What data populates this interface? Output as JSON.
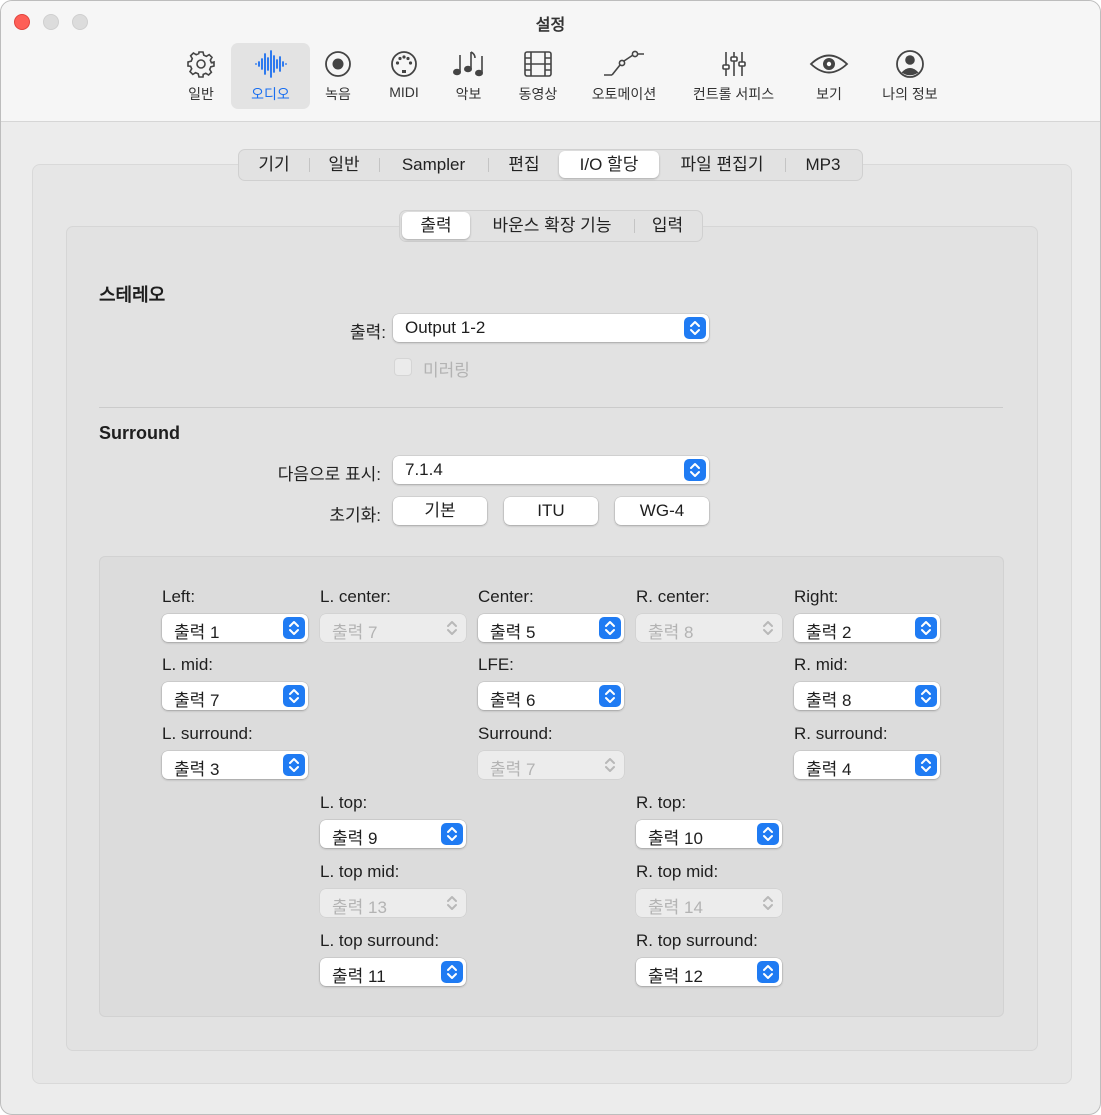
{
  "window": {
    "title": "설정"
  },
  "toolbar": {
    "items": [
      {
        "label": "일반",
        "icon": "gear-icon"
      },
      {
        "label": "오디오",
        "icon": "waveform-icon"
      },
      {
        "label": "녹음",
        "icon": "record-icon"
      },
      {
        "label": "MIDI",
        "icon": "midi-port-icon"
      },
      {
        "label": "악보",
        "icon": "music-notes-icon"
      },
      {
        "label": "동영상",
        "icon": "film-icon"
      },
      {
        "label": "오토메이션",
        "icon": "automation-curve-icon"
      },
      {
        "label": "컨트롤 서피스",
        "icon": "sliders-icon"
      },
      {
        "label": "보기",
        "icon": "eye-icon"
      },
      {
        "label": "나의 정보",
        "icon": "person-circle-icon"
      }
    ],
    "selected": "오디오"
  },
  "tabs": [
    "기기",
    "일반",
    "Sampler",
    "편집",
    "I/O 할당",
    "파일 편집기",
    "MP3"
  ],
  "selected_tab": "I/O 할당",
  "subtabs": [
    "출력",
    "바운스 확장 기능",
    "입력"
  ],
  "selected_subtab": "출력",
  "stereo": {
    "title": "스테레오",
    "output_label": "출력:",
    "output_value": "Output 1-2",
    "mirroring_label": "미러링",
    "mirroring_checked": false
  },
  "surround": {
    "title": "Surround",
    "display_as_label": "다음으로 표시:",
    "display_as_value": "7.1.4",
    "reset_label": "초기화:",
    "reset_buttons": [
      "기본",
      "ITU",
      "WG-4"
    ],
    "channels": {
      "left": {
        "label": "Left:",
        "value": "출력 1",
        "enabled": true
      },
      "l_center": {
        "label": "L. center:",
        "value": "출력 7",
        "enabled": false
      },
      "center": {
        "label": "Center:",
        "value": "출력 5",
        "enabled": true
      },
      "r_center": {
        "label": "R. center:",
        "value": "출력 8",
        "enabled": false
      },
      "right": {
        "label": "Right:",
        "value": "출력 2",
        "enabled": true
      },
      "l_mid": {
        "label": "L. mid:",
        "value": "출력 7",
        "enabled": true
      },
      "lfe": {
        "label": "LFE:",
        "value": "출력 6",
        "enabled": true
      },
      "r_mid": {
        "label": "R. mid:",
        "value": "출력 8",
        "enabled": true
      },
      "l_surround": {
        "label": "L. surround:",
        "value": "출력 3",
        "enabled": true
      },
      "surround": {
        "label": "Surround:",
        "value": "출력 7",
        "enabled": false
      },
      "r_surround": {
        "label": "R. surround:",
        "value": "출력 4",
        "enabled": true
      },
      "l_top": {
        "label": "L. top:",
        "value": "출력 9",
        "enabled": true
      },
      "r_top": {
        "label": "R. top:",
        "value": "출력 10",
        "enabled": true
      },
      "l_top_mid": {
        "label": "L. top mid:",
        "value": "출력 13",
        "enabled": false
      },
      "r_top_mid": {
        "label": "R. top mid:",
        "value": "출력 14",
        "enabled": false
      },
      "l_top_surround": {
        "label": "L. top surround:",
        "value": "출력 11",
        "enabled": true
      },
      "r_top_surround": {
        "label": "R. top surround:",
        "value": "출력 12",
        "enabled": true
      }
    }
  },
  "colors": {
    "accent": "#1f7bf3",
    "close": "#fe5f57"
  }
}
